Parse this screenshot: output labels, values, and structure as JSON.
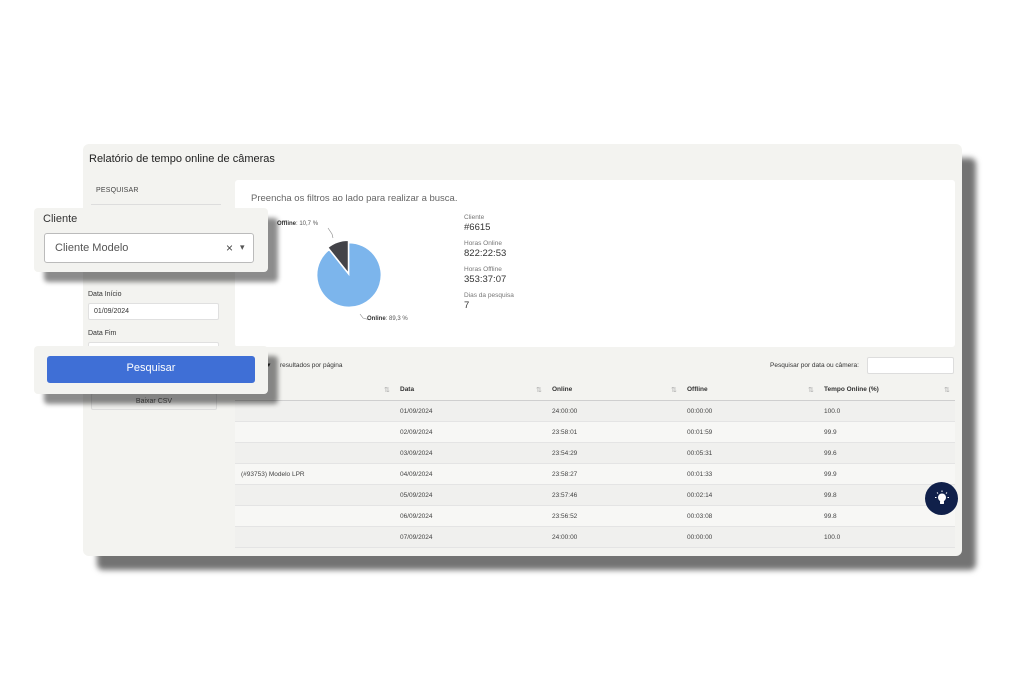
{
  "window": {
    "title": "Relatório de tempo online de câmeras"
  },
  "sidebar": {
    "search_label": "PESQUISAR",
    "data_inicio_label": "Data Início",
    "data_inicio_value": "01/09/2024",
    "data_fim_label": "Data Fim",
    "csv_button": "Baixar CSV"
  },
  "cliente_card": {
    "label": "Cliente",
    "selected": "Cliente Modelo",
    "clear": "×",
    "caret": "▾"
  },
  "search_button": "Pesquisar",
  "summary": {
    "hint": "Preencha os filtros ao lado para realizar a busca.",
    "stats": [
      {
        "label": "Cliente",
        "value": "#6615"
      },
      {
        "label": "Horas Online",
        "value": "822:22:53"
      },
      {
        "label": "Horas Offline",
        "value": "353:37:07"
      },
      {
        "label": "Dias da pesquisa",
        "value": "7"
      }
    ]
  },
  "chart_data": {
    "type": "pie",
    "slices": [
      {
        "label": "Online",
        "value": 89.3,
        "display": "89,3 %",
        "color": "#7cb5ec"
      },
      {
        "label": "Offline",
        "value": 10.7,
        "display": "10,7 %",
        "color": "#434348"
      }
    ]
  },
  "table": {
    "per_page_label": "resultados por página",
    "per_page_caret": "▾",
    "search_label": "Pesquisar por data ou câmera:",
    "columns": [
      "Data",
      "Online",
      "Offline",
      "Tempo Online (%)"
    ],
    "camera": "(#93753) Modelo LPR",
    "rows": [
      [
        "01/09/2024",
        "24:00:00",
        "00:00:00",
        "100.0"
      ],
      [
        "02/09/2024",
        "23:58:01",
        "00:01:59",
        "99.9"
      ],
      [
        "03/09/2024",
        "23:54:29",
        "00:05:31",
        "99.6"
      ],
      [
        "04/09/2024",
        "23:58:27",
        "00:01:33",
        "99.9"
      ],
      [
        "05/09/2024",
        "23:57:46",
        "00:02:14",
        "99.8"
      ],
      [
        "06/09/2024",
        "23:56:52",
        "00:03:08",
        "99.8"
      ],
      [
        "07/09/2024",
        "24:00:00",
        "00:00:00",
        "100.0"
      ]
    ]
  },
  "icons": {
    "help": "lightbulb-icon",
    "sort": "sort-icon"
  }
}
